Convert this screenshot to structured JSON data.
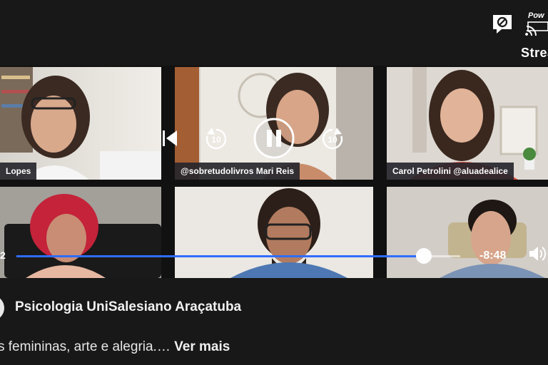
{
  "brand": {
    "powered": "Pow",
    "stream_label": "Strea"
  },
  "icons": {
    "top_chat": "no-comments-icon",
    "top_stream": "stream-icon",
    "prev": "previous-icon",
    "rewind": "rewind-10-icon",
    "forward": "forward-10-icon",
    "pause": "pause-icon",
    "volume": "volume-icon"
  },
  "participants": [
    {
      "name": "Lopes"
    },
    {
      "name": "@sobretudolivros Mari Reis"
    },
    {
      "name": "Carol Petrolini @aluadealice"
    }
  ],
  "player": {
    "elapsed": "2",
    "remaining": "-8:48",
    "rewind_seconds": "10",
    "forward_seconds": "10",
    "progress": 0.918,
    "progress_color": "#2f6dff"
  },
  "post": {
    "page_name": "Psicologia UniSalesiano Araçatuba",
    "description": "s femininas, arte e alegria.…",
    "see_more": "Ver mais"
  }
}
